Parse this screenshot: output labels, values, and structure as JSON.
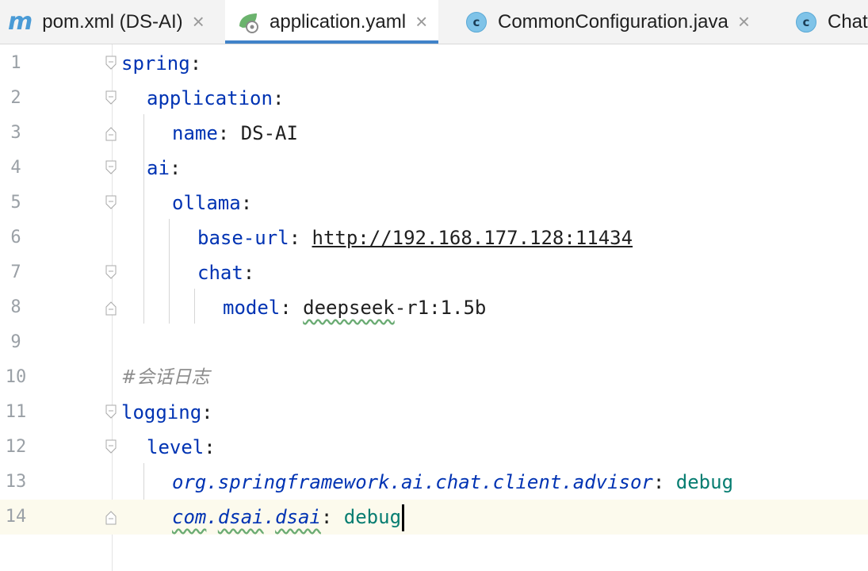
{
  "tabs": [
    {
      "label": "pom.xml (DS-AI)",
      "icon": "maven-icon",
      "active": false,
      "closable": true
    },
    {
      "label": "application.yaml",
      "icon": "spring-leaf-icon",
      "active": true,
      "closable": true
    },
    {
      "label": "CommonConfiguration.java",
      "icon": "java-class-icon",
      "active": false,
      "closable": true
    },
    {
      "label": "Chat",
      "icon": "java-class-icon",
      "active": false,
      "closable": false
    }
  ],
  "tab_close_glyph": "×",
  "class_icon_letter": "c",
  "maven_icon_letter": "m",
  "current_line": 14,
  "lines": [
    {
      "n": "1",
      "key": "spring",
      "sep": ":"
    },
    {
      "n": "2",
      "key": "application",
      "sep": ":"
    },
    {
      "n": "3",
      "key": "name",
      "sep": ": ",
      "value": "DS-AI"
    },
    {
      "n": "4",
      "key": "ai",
      "sep": ":"
    },
    {
      "n": "5",
      "key": "ollama",
      "sep": ":"
    },
    {
      "n": "6",
      "key": "base-url",
      "sep": ": ",
      "value": "http://192.168.177.128:11434"
    },
    {
      "n": "7",
      "key": "chat",
      "sep": ":"
    },
    {
      "n": "8",
      "key": "model",
      "sep": ": ",
      "value_a": "deepseek",
      "value_b": "-r1:1.5b"
    },
    {
      "n": "9"
    },
    {
      "n": "10",
      "comment": "#会话日志"
    },
    {
      "n": "11",
      "key": "logging",
      "sep": ":"
    },
    {
      "n": "12",
      "key": "level",
      "sep": ":"
    },
    {
      "n": "13",
      "key": "org.springframework.ai.chat.client.advisor",
      "sep": ": ",
      "value": "debug"
    },
    {
      "n": "14",
      "key_a": "com",
      "key_b": ".",
      "key_c": "dsai",
      "key_d": ".",
      "key_e": "dsai",
      "sep": ": ",
      "value": "debug"
    }
  ]
}
